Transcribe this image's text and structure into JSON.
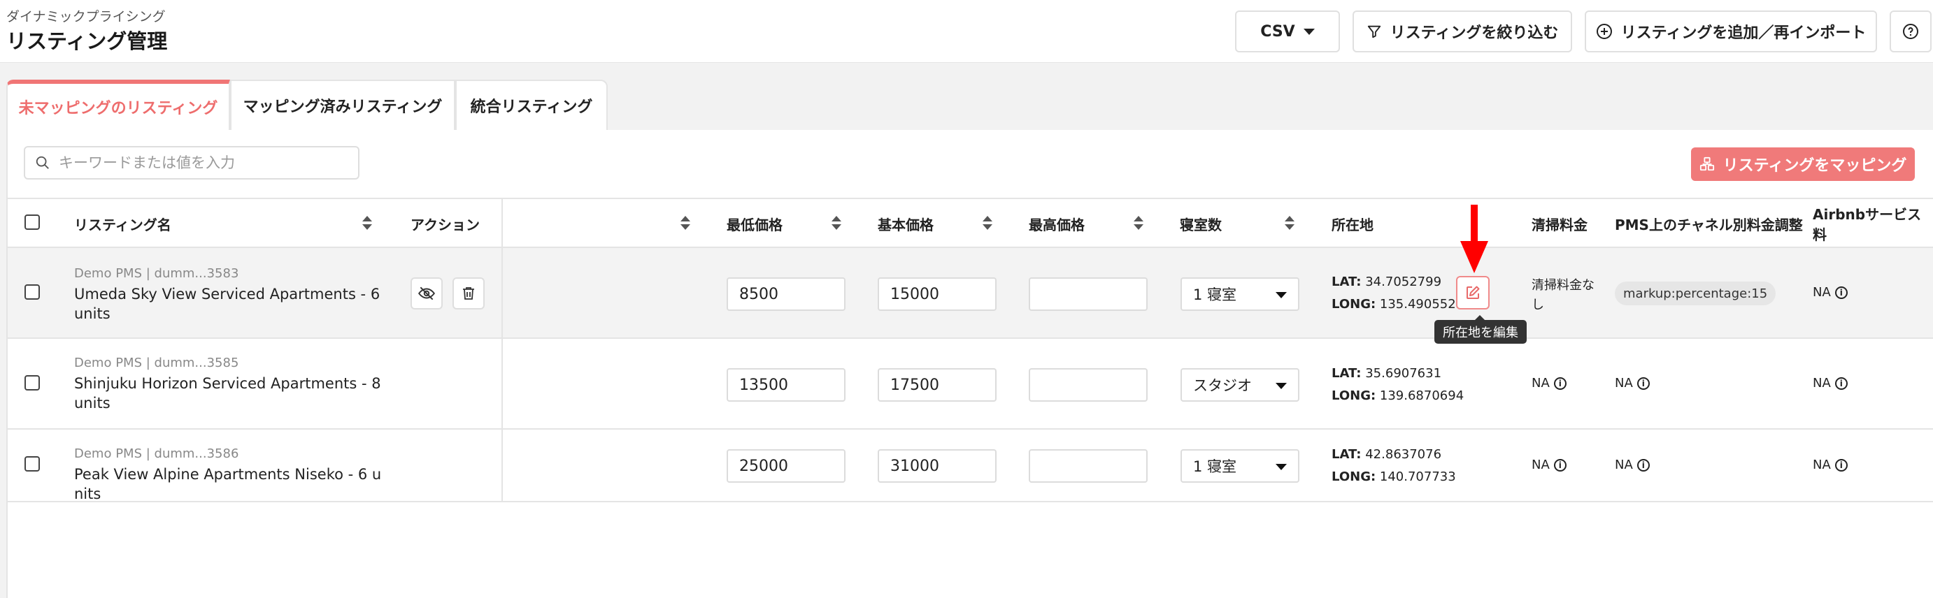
{
  "header": {
    "subtitle": "ダイナミックプライシング",
    "title": "リスティング管理",
    "csv_label": "CSV",
    "filter_label": "リスティングを絞り込む",
    "add_label": "リスティングを追加／再インポート"
  },
  "tabs": [
    {
      "label": "未マッピングのリスティング",
      "active": true
    },
    {
      "label": "マッピング済みリスティング",
      "active": false
    },
    {
      "label": "統合リスティング",
      "active": false
    }
  ],
  "toolbar": {
    "search_placeholder": "キーワードまたは値を入力",
    "map_button_label": "リスティングをマッピング"
  },
  "table": {
    "columns": {
      "name": "リスティング名",
      "action": "アクション",
      "min_price": "最低価格",
      "base_price": "基本価格",
      "max_price": "最高価格",
      "bedrooms": "寝室数",
      "location": "所在地",
      "cleaning_fee": "清掃料金",
      "pms_channel": "PMS上のチャネル別料金調整",
      "airbnb_fee": "Airbnbサービス料"
    },
    "lat_label": "LAT:",
    "long_label": "LONG:",
    "rows": [
      {
        "pms": "Demo PMS | dumm...3583",
        "name": "Umeda Sky View Serviced Apartments - 6 units",
        "min_price": "8500",
        "base_price": "15000",
        "max_price": "",
        "bedrooms": "1 寝室",
        "lat": "34.7052799",
        "long": "135.490552",
        "cleaning_fee": "清掃料金なし",
        "pms_channel": "markup:percentage:15",
        "airbnb_fee": "NA"
      },
      {
        "pms": "Demo PMS | dumm...3585",
        "name": "Shinjuku Horizon Serviced Apartments - 8 units",
        "min_price": "13500",
        "base_price": "17500",
        "max_price": "",
        "bedrooms": "スタジオ",
        "lat": "35.6907631",
        "long": "139.6870694",
        "cleaning_fee": "NA",
        "pms_channel": "NA",
        "airbnb_fee": "NA"
      },
      {
        "pms": "Demo PMS | dumm...3586",
        "name": "Peak View Alpine Apartments Niseko - 6 units",
        "min_price": "25000",
        "base_price": "31000",
        "max_price": "",
        "bedrooms": "1 寝室",
        "lat": "42.8637076",
        "long": "140.707733",
        "cleaning_fee": "NA",
        "pms_channel": "NA",
        "airbnb_fee": "NA"
      }
    ]
  },
  "tooltip": "所在地を編集",
  "colors": {
    "accent": "#f07575",
    "annotation_arrow": "#ff0000"
  },
  "icons": [
    "search-icon",
    "filter-icon",
    "add-circle-icon",
    "help-icon",
    "map-icon",
    "hide-icon",
    "trash-icon",
    "edit-icon",
    "info-icon"
  ]
}
